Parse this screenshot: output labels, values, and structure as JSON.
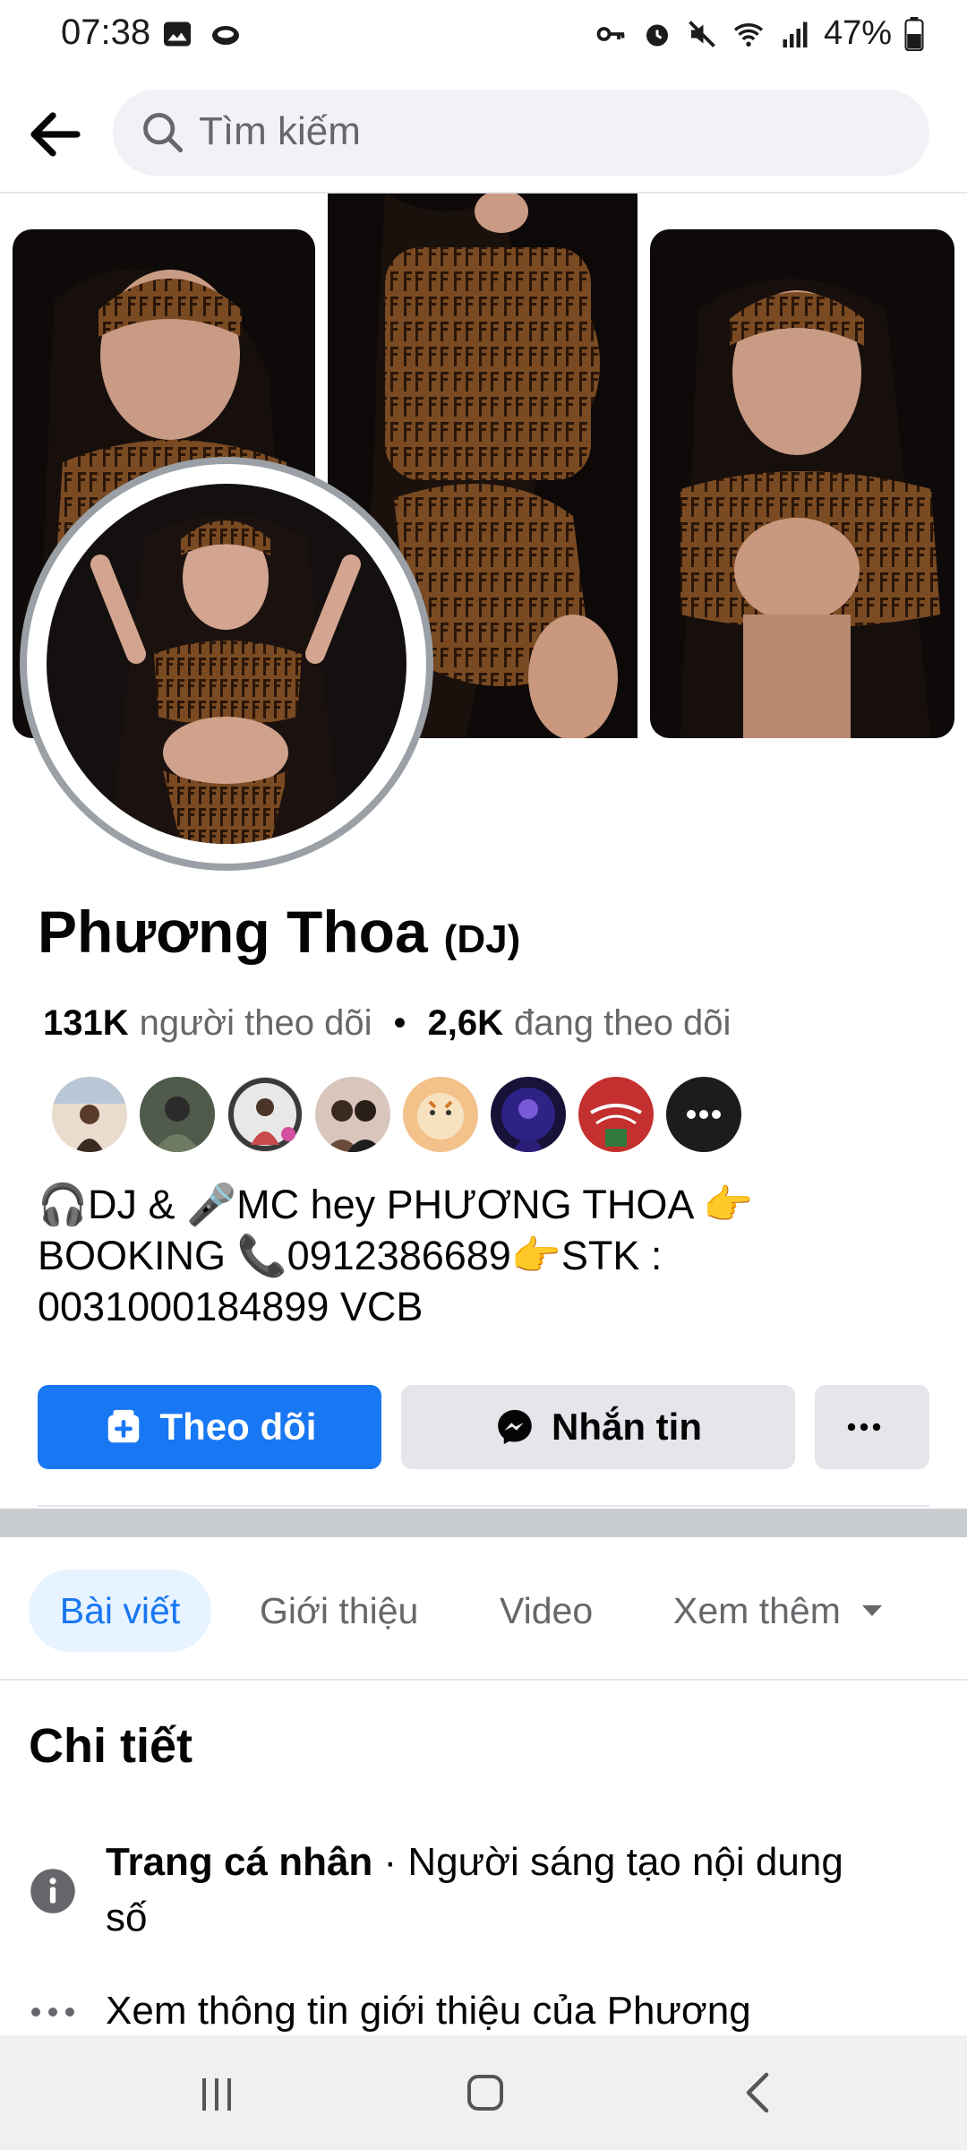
{
  "status": {
    "time": "07:38",
    "battery_pct": "47%",
    "left_icons": [
      "image-icon",
      "cloud-icon"
    ],
    "right_icons": [
      "key-icon",
      "alarm-icon",
      "mute-icon",
      "wifi-icon",
      "signal-icon",
      "battery-icon"
    ]
  },
  "search": {
    "placeholder": "Tìm kiếm"
  },
  "profile": {
    "name": "Phương Thoa",
    "tag": "(DJ)",
    "followers_count": "131K",
    "followers_label": "người theo dõi",
    "following_count": "2,6K",
    "following_label": "đang theo dõi",
    "bio_line1": "🎧DJ & 🎤MC hey PHƯƠNG THOA 👉",
    "bio_line2": "BOOKING 📞0912386689👉STK :",
    "bio_line3": "0031000184899 VCB"
  },
  "actions": {
    "follow_label": "Theo dõi",
    "message_label": "Nhắn tin"
  },
  "tabs": [
    {
      "label": "Bài viết"
    },
    {
      "label": "Giới thiệu"
    },
    {
      "label": "Video"
    },
    {
      "label": "Xem thêm"
    }
  ],
  "details": {
    "title": "Chi tiết",
    "row1_bold": "Trang cá nhân",
    "row1_rest": " · Người sáng tạo nội dung",
    "row1_line2": "số",
    "row2_text": "Xem thông tin giới thiệu của Phương"
  },
  "colors": {
    "accent": "#1877f2",
    "secondary_button": "#e4e6eb",
    "muted_text": "#65676b"
  }
}
